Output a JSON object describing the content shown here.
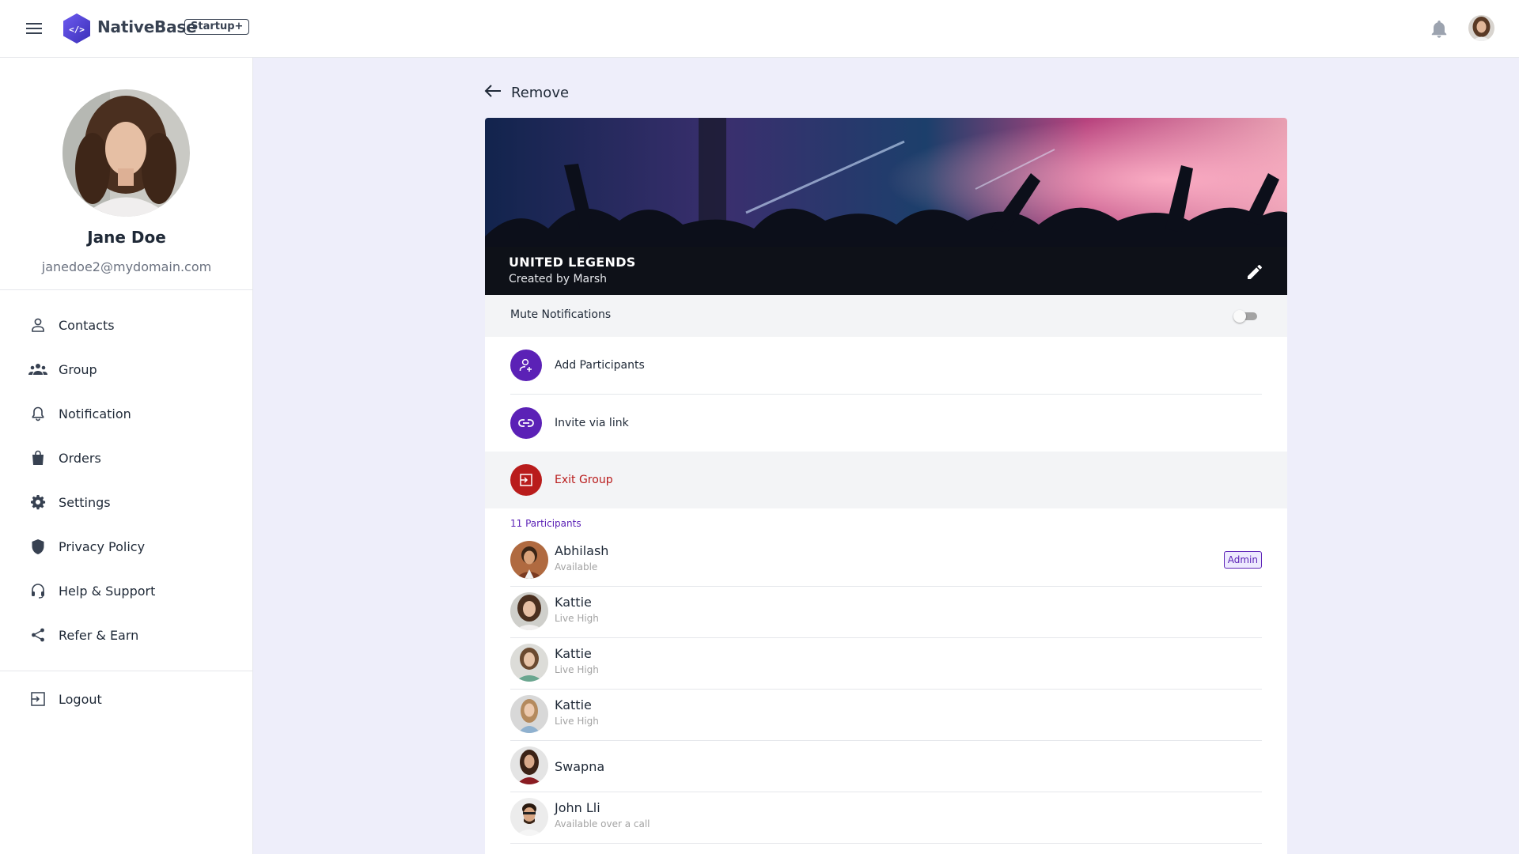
{
  "header": {
    "brand": "NativeBase",
    "plan": "Startup+"
  },
  "sidebar": {
    "profile": {
      "name": "Jane Doe",
      "email": "janedoe2@mydomain.com"
    },
    "items": [
      {
        "label": "Contacts",
        "icon": "person-icon"
      },
      {
        "label": "Group",
        "icon": "group-icon"
      },
      {
        "label": "Notification",
        "icon": "bell-icon"
      },
      {
        "label": "Orders",
        "icon": "shopping-bag-icon"
      },
      {
        "label": "Settings",
        "icon": "gear-icon"
      },
      {
        "label": "Privacy Policy",
        "icon": "shield-icon"
      },
      {
        "label": "Help & Support",
        "icon": "headset-icon"
      },
      {
        "label": "Refer & Earn",
        "icon": "share-icon"
      }
    ],
    "logout": {
      "label": "Logout",
      "icon": "logout-icon"
    }
  },
  "main": {
    "back_label": "Remove",
    "group": {
      "title": "UNITED LEGENDS",
      "creator": "Created by Marsh"
    },
    "mute": {
      "label": "Mute Notifications",
      "enabled": false
    },
    "actions": {
      "add": "Add Participants",
      "invite": "Invite via link",
      "exit": "Exit Group"
    },
    "participants_count": "11 Participants",
    "participants": [
      {
        "name": "Abhilash",
        "status": "Available",
        "badge": "Admin"
      },
      {
        "name": "Kattie",
        "status": "Live High"
      },
      {
        "name": "Kattie",
        "status": "Live High"
      },
      {
        "name": "Kattie",
        "status": "Live High"
      },
      {
        "name": "Swapna",
        "status": ""
      },
      {
        "name": "John Lli",
        "status": "Available over a call"
      }
    ]
  },
  "colors": {
    "accent": "#5b21b6",
    "danger": "#b91c1c",
    "background": "#eeeefa"
  }
}
